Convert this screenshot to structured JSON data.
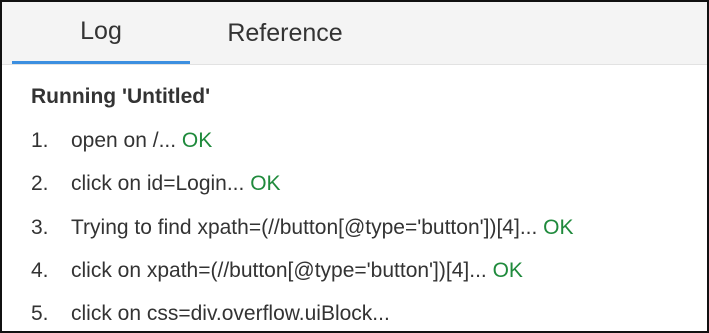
{
  "tabs": {
    "log": "Log",
    "reference": "Reference"
  },
  "log": {
    "title": "Running 'Untitled'",
    "status_color": "#1f8a3c",
    "active_tab_accent": "#3c8fe0",
    "entries": [
      {
        "number": "1.",
        "text": "open on /... ",
        "status": "OK"
      },
      {
        "number": "2.",
        "text": "click on id=Login... ",
        "status": "OK"
      },
      {
        "number": "3.",
        "text": "Trying to find xpath=(//button[@type='button'])[4]... ",
        "status": "OK"
      },
      {
        "number": "4.",
        "text": "click on xpath=(//button[@type='button'])[4]... ",
        "status": "OK"
      },
      {
        "number": "5.",
        "text": "click on css=div.overflow.uiBlock...",
        "status": ""
      }
    ]
  }
}
